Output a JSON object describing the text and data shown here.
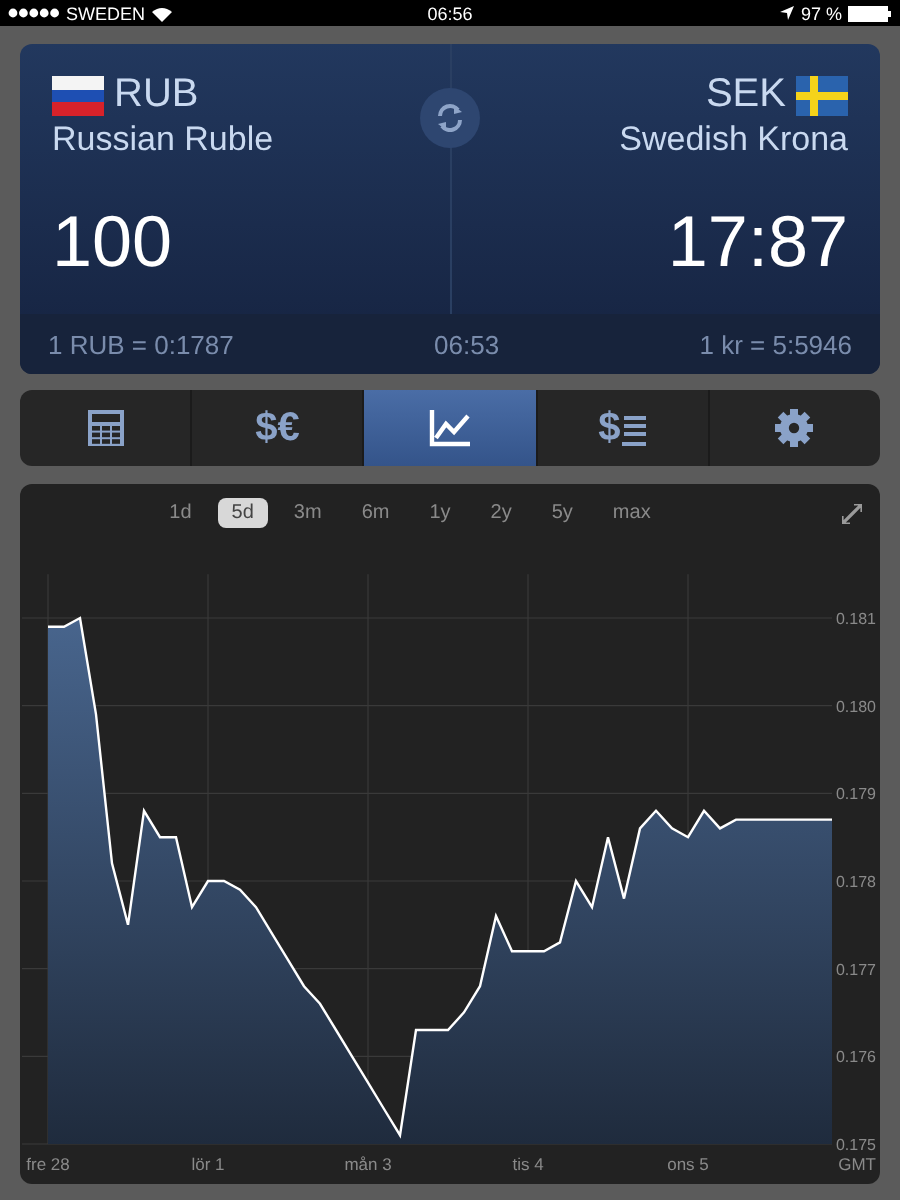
{
  "status_bar": {
    "carrier": "SWEDEN",
    "time": "06:56",
    "battery": "97 %"
  },
  "converter": {
    "from": {
      "code": "RUB",
      "name": "Russian Ruble",
      "amount": "100",
      "kind": "ru"
    },
    "to": {
      "code": "SEK",
      "name": "Swedish Krona",
      "amount": "17:87",
      "kind": "se"
    },
    "rate_from": "1 RUB = 0:1787",
    "updated": "06:53",
    "rate_to": "1 kr = 5:5946"
  },
  "tabs": [
    {
      "kind": "calculator",
      "selected": false
    },
    {
      "kind": "currencies",
      "label": "$€",
      "selected": false
    },
    {
      "kind": "chart",
      "selected": true
    },
    {
      "kind": "rates",
      "label": "$",
      "selected": false
    },
    {
      "kind": "settings",
      "selected": false
    }
  ],
  "chart": {
    "ranges": [
      {
        "label": "1d",
        "selected": false
      },
      {
        "label": "5d",
        "selected": true
      },
      {
        "label": "3m",
        "selected": false
      },
      {
        "label": "6m",
        "selected": false
      },
      {
        "label": "1y",
        "selected": false
      },
      {
        "label": "2y",
        "selected": false
      },
      {
        "label": "5y",
        "selected": false
      },
      {
        "label": "max",
        "selected": false
      }
    ],
    "timezone": "GMT",
    "chart_data": {
      "type": "area",
      "categories": [
        "fre 28",
        null,
        null,
        null,
        null,
        null,
        null,
        null,
        null,
        null,
        "lör 1",
        null,
        null,
        null,
        null,
        null,
        null,
        null,
        null,
        null,
        "mån 3",
        null,
        null,
        null,
        null,
        null,
        null,
        null,
        null,
        null,
        "tis 4",
        null,
        null,
        null,
        null,
        null,
        null,
        null,
        null,
        null,
        "ons 5",
        null,
        null,
        null,
        null,
        null,
        null,
        null,
        null,
        null
      ],
      "series": [
        {
          "color": "#ffffff",
          "values": [
            0.1809,
            0.1809,
            0.181,
            0.1799,
            0.1782,
            0.1775,
            0.1788,
            0.1785,
            0.1785,
            0.1777,
            0.178,
            0.178,
            0.1779,
            0.1777,
            0.1774,
            0.1771,
            0.1768,
            0.1766,
            0.1763,
            0.176,
            0.1757,
            0.1754,
            0.1751,
            0.1763,
            0.1763,
            0.1763,
            0.1765,
            0.1768,
            0.1776,
            0.1772,
            0.1772,
            0.1772,
            0.1773,
            0.178,
            0.1777,
            0.1785,
            0.1778,
            0.1786,
            0.1788,
            0.1786,
            0.1785,
            0.1788,
            0.1786,
            0.1787,
            0.1787,
            0.1787,
            0.1787,
            0.1787,
            0.1787,
            0.1787
          ]
        }
      ],
      "ylim": [
        0.175,
        0.1815
      ],
      "grid": true,
      "yticks": [
        {
          "value": 0.175,
          "label": "0.175"
        },
        {
          "value": 0.176,
          "label": "0.176"
        },
        {
          "value": 0.177,
          "label": "0.177"
        },
        {
          "value": 0.178,
          "label": "0.178"
        },
        {
          "value": 0.179,
          "label": "0.179"
        },
        {
          "value": 0.18,
          "label": "0.180"
        },
        {
          "value": 0.181,
          "label": "0.181"
        }
      ]
    }
  }
}
